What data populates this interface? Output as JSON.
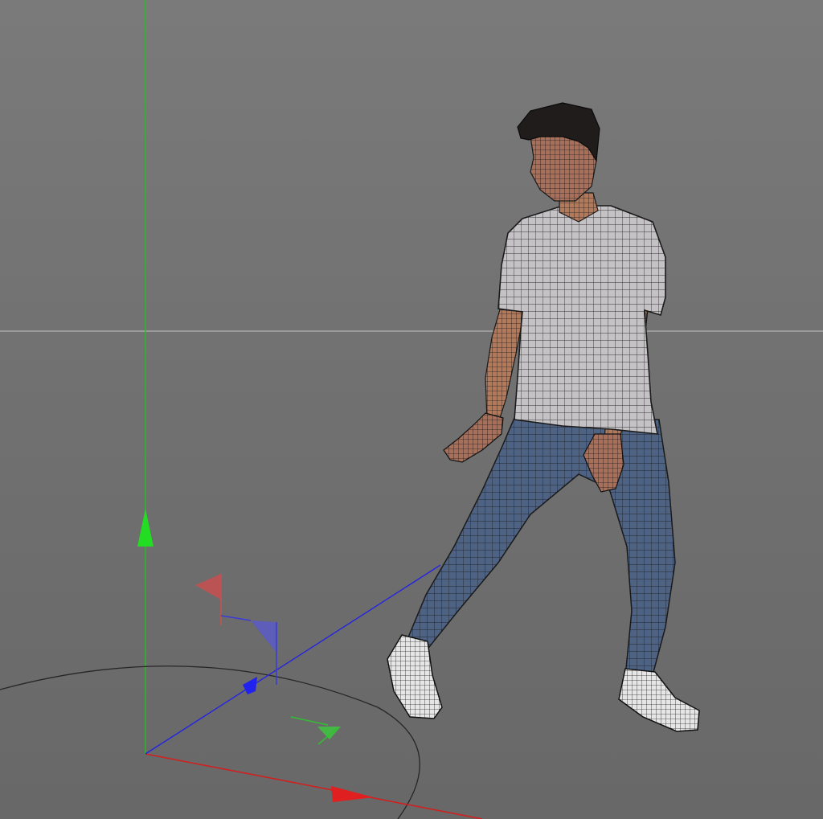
{
  "viewport": {
    "background_top": "#7a7a7a",
    "background_bottom": "#686868",
    "horizon_color": "#b4b4b4"
  },
  "gizmo": {
    "axis_x_color": "#e02020",
    "axis_y_color": "#20d020",
    "axis_z_color": "#2020e0",
    "icons": [
      "move-x-arrow-icon",
      "move-y-arrow-icon",
      "move-z-arrow-icon",
      "rotate-ring-icon",
      "plane-handle-icon"
    ]
  },
  "model": {
    "icon": "human-mesh-icon",
    "skin_color": "#b27a5a",
    "shirt_color": "#c4c2c5",
    "jeans_color": "#4e6384",
    "hair_color": "#1f1c1b",
    "shoe_color": "#e6e6e6",
    "wire_color": "#1a1a1a"
  }
}
